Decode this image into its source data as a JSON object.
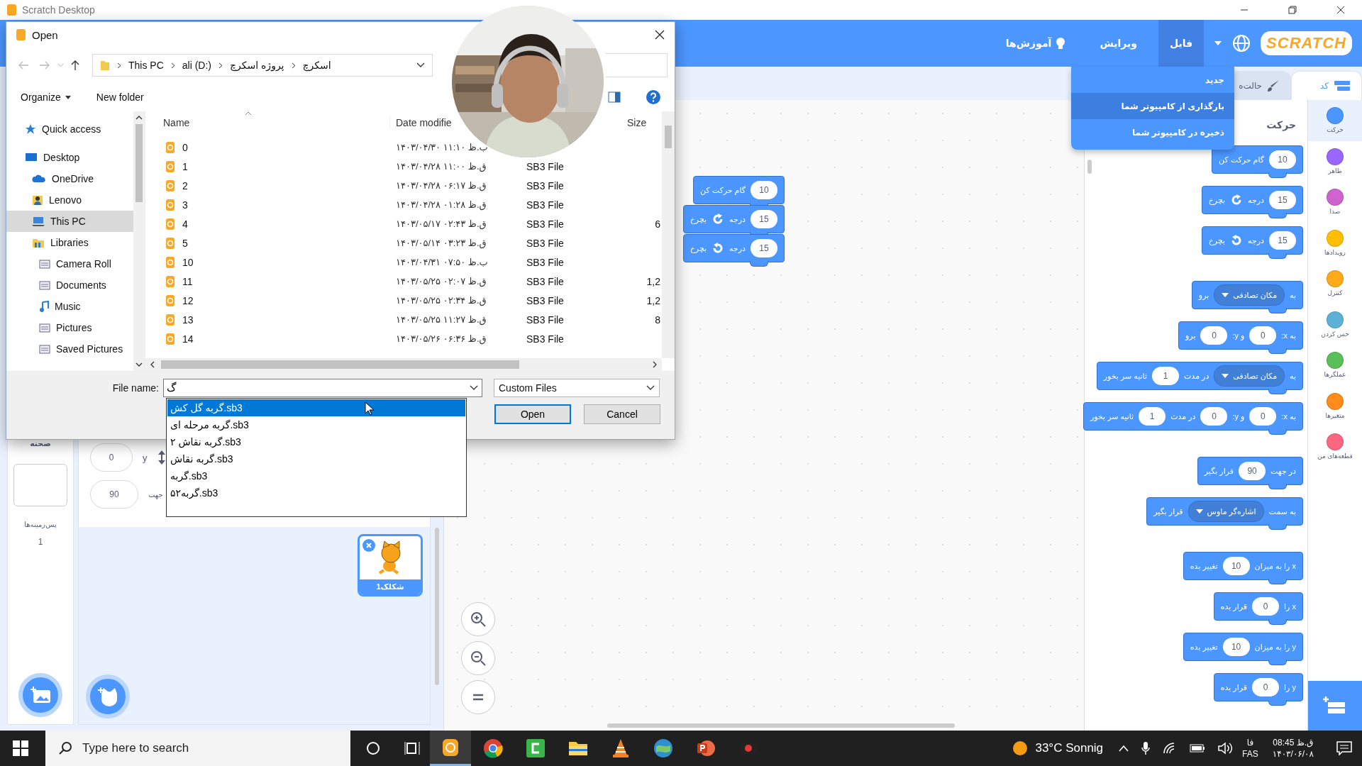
{
  "app_window": {
    "title": "Scratch Desktop"
  },
  "menu_bar": {
    "logo": "SCRATCH",
    "items": [
      {
        "label": "فایل",
        "selected": true,
        "kind": "plain"
      },
      {
        "label": "ویرایش",
        "selected": false,
        "kind": "plain"
      },
      {
        "label": "آموزش‌ها",
        "selected": false,
        "kind": "bulb"
      }
    ]
  },
  "file_menu": [
    {
      "label": "جدید",
      "selected": false
    },
    {
      "label": "بارگذاری از کامپیوتر شما",
      "selected": true
    },
    {
      "label": "ذخیره در کامپیوتر شما",
      "selected": false
    }
  ],
  "editor_tabs": [
    {
      "label": "کد",
      "selected": true,
      "kind": "code"
    },
    {
      "label": "حالت‌ه",
      "selected": false,
      "kind": "costumes"
    }
  ],
  "categories": [
    {
      "label": "حرکت",
      "color": "#4c97ff",
      "selected": true
    },
    {
      "label": "ظاهر",
      "color": "#9966ff",
      "selected": false
    },
    {
      "label": "صدا",
      "color": "#cf63cf",
      "selected": false
    },
    {
      "label": "رویدادها",
      "color": "#ffbf00",
      "selected": false
    },
    {
      "label": "کنترل",
      "color": "#ffab19",
      "selected": false
    },
    {
      "label": "حس کردن",
      "color": "#5cb1d6",
      "selected": false
    },
    {
      "label": "عملگرها",
      "color": "#59c059",
      "selected": false
    },
    {
      "label": "متغیرها",
      "color": "#ff8c1a",
      "selected": false
    },
    {
      "label": "قطعه‌های من",
      "color": "#ff6680",
      "selected": false
    }
  ],
  "palette": {
    "heading": "حرکت",
    "groups": [
      [
        {
          "parts": [
            {
              "kind": "input",
              "text": "10"
            },
            {
              "kind": "text",
              "text": "گام حرکت کن"
            }
          ]
        },
        {
          "parts": [
            {
              "kind": "input",
              "text": "15"
            },
            {
              "kind": "text",
              "text": "درجه"
            },
            {
              "kind": "turn-right"
            },
            {
              "kind": "text",
              "text": "بچرخ"
            }
          ]
        },
        {
          "parts": [
            {
              "kind": "input",
              "text": "15"
            },
            {
              "kind": "text",
              "text": "درجه"
            },
            {
              "kind": "turn-left"
            },
            {
              "kind": "text",
              "text": "بچرخ"
            }
          ]
        }
      ],
      [
        {
          "parts": [
            {
              "kind": "text",
              "text": "به"
            },
            {
              "kind": "menu",
              "text": "مکان تصادفی"
            },
            {
              "kind": "text",
              "text": "برو"
            }
          ]
        },
        {
          "parts": [
            {
              "kind": "text",
              "text": "به x:"
            },
            {
              "kind": "input",
              "text": "0"
            },
            {
              "kind": "text",
              "text": "و y:"
            },
            {
              "kind": "input",
              "text": "0"
            },
            {
              "kind": "text",
              "text": "برو"
            }
          ]
        },
        {
          "parts": [
            {
              "kind": "text",
              "text": "به"
            },
            {
              "kind": "menu",
              "text": "مکان تصادفی"
            },
            {
              "kind": "text",
              "text": "در مدت"
            },
            {
              "kind": "input",
              "text": "1"
            },
            {
              "kind": "text",
              "text": "ثانیه سر بخور"
            }
          ]
        },
        {
          "parts": [
            {
              "kind": "text",
              "text": "به x:"
            },
            {
              "kind": "input",
              "text": "0"
            },
            {
              "kind": "text",
              "text": "و y:"
            },
            {
              "kind": "input",
              "text": "0"
            },
            {
              "kind": "text",
              "text": "در مدت"
            },
            {
              "kind": "input",
              "text": "1"
            },
            {
              "kind": "text",
              "text": "ثانیه سر بخور"
            }
          ]
        }
      ],
      [
        {
          "parts": [
            {
              "kind": "text",
              "text": "در جهت"
            },
            {
              "kind": "input",
              "text": "90"
            },
            {
              "kind": "text",
              "text": "قرار بگیر"
            }
          ]
        },
        {
          "parts": [
            {
              "kind": "text",
              "text": "به سمت"
            },
            {
              "kind": "menu",
              "text": "اشاره‌گر ماوس"
            },
            {
              "kind": "text",
              "text": "قرار بگیر"
            }
          ]
        }
      ],
      [
        {
          "parts": [
            {
              "kind": "text",
              "text": "x را به میزان"
            },
            {
              "kind": "input",
              "text": "10"
            },
            {
              "kind": "text",
              "text": "تغییر بده"
            }
          ]
        },
        {
          "parts": [
            {
              "kind": "text",
              "text": "x را"
            },
            {
              "kind": "input",
              "text": "0"
            },
            {
              "kind": "text",
              "text": "قرار بده"
            }
          ]
        },
        {
          "parts": [
            {
              "kind": "text",
              "text": "y را به میزان"
            },
            {
              "kind": "input",
              "text": "10"
            },
            {
              "kind": "text",
              "text": "تغییر بده"
            }
          ]
        },
        {
          "parts": [
            {
              "kind": "text",
              "text": "y را"
            },
            {
              "kind": "input",
              "text": "0"
            },
            {
              "kind": "text",
              "text": "قرار بده"
            }
          ]
        }
      ]
    ]
  },
  "workspace": {
    "blocks": [
      {
        "parts": [
          {
            "kind": "input",
            "text": "10"
          },
          {
            "kind": "text",
            "text": "گام حرکت کن"
          }
        ]
      },
      {
        "parts": [
          {
            "kind": "input",
            "text": "15"
          },
          {
            "kind": "text",
            "text": "درجه"
          },
          {
            "kind": "turn-right"
          },
          {
            "kind": "text",
            "text": "بچرخ"
          }
        ]
      },
      {
        "parts": [
          {
            "kind": "input",
            "text": "15"
          },
          {
            "kind": "text",
            "text": "درجه"
          },
          {
            "kind": "turn-left"
          },
          {
            "kind": "text",
            "text": "بچرخ"
          }
        ]
      }
    ]
  },
  "sprite_info": {
    "y_value": "0",
    "y_label": "y",
    "direction": "90",
    "direction_label": "جهت"
  },
  "sprites": [
    {
      "name": "شکلک1",
      "selected": true
    }
  ],
  "stage_panel": {
    "title": "صحنه",
    "backdrops_label": "پس‌زمینه‌ها",
    "backdrop_count": "1"
  },
  "open_dialog": {
    "title": "Open",
    "path": {
      "computer": "This PC",
      "drive": "ali (D:)",
      "parent_folder": "پروژه اسکرچ",
      "folder": "اسکرچ"
    },
    "toolbar": {
      "organize": "Organize",
      "new_folder": "New folder"
    },
    "nav": [
      {
        "label": "Quick access",
        "kind": "star",
        "selected": false
      },
      {
        "label": "Desktop",
        "kind": "desktop",
        "selected": false,
        "children": [
          {
            "label": "OneDrive",
            "kind": "cloud",
            "selected": false
          },
          {
            "label": "Lenovo",
            "kind": "user",
            "selected": false
          },
          {
            "label": "This PC",
            "kind": "pc",
            "selected": true
          },
          {
            "label": "Libraries",
            "kind": "library",
            "selected": false,
            "children": [
              {
                "label": "Camera Roll",
                "kind": "folder",
                "selected": false
              },
              {
                "label": "Documents",
                "kind": "folder",
                "selected": false
              },
              {
                "label": "Music",
                "kind": "music",
                "selected": false
              },
              {
                "label": "Pictures",
                "kind": "folder",
                "selected": false
              },
              {
                "label": "Saved Pictures",
                "kind": "folder",
                "selected": false
              }
            ]
          }
        ]
      }
    ],
    "columns": {
      "name": "Name",
      "date_modified": "Date modifie",
      "size": "Size"
    },
    "files": [
      {
        "name": "0",
        "date": "۱۴۰۳/۰۴/۳۰ ب.ظ ۱۱:۱۰"
      },
      {
        "name": "1",
        "date": "۱۴۰۳/۰۴/۲۸ ق.ظ ۱۱:۰۰",
        "type": "SB3 File"
      },
      {
        "name": "2",
        "date": "۱۴۰۳/۰۴/۲۸ ق.ظ ۰۶:۱۷",
        "type": "SB3 File"
      },
      {
        "name": "3",
        "date": "۱۴۰۳/۰۴/۲۸ ق.ظ ۰۱:۲۸",
        "type": "SB3 File"
      },
      {
        "name": "4",
        "date": "۱۴۰۳/۰۵/۱۷ ق.ظ ۰۲:۴۳",
        "type": "SB3 File",
        "size": "6"
      },
      {
        "name": "5",
        "date": "۱۴۰۳/۰۵/۱۴ ق.ظ ۰۳:۲۳",
        "type": "SB3 File"
      },
      {
        "name": "10",
        "date": "۱۴۰۳/۰۴/۳۱ ب.ظ ۰۷:۵۰",
        "type": "SB3 File"
      },
      {
        "name": "11",
        "date": "۱۴۰۳/۰۵/۲۵ ق.ظ ۰۲:۰۷",
        "type": "SB3 File",
        "size": "1,2"
      },
      {
        "name": "12",
        "date": "۱۴۰۳/۰۵/۲۵ ق.ظ ۰۲:۳۴",
        "type": "SB3 File",
        "size": "1,2"
      },
      {
        "name": "13",
        "date": "۱۴۰۳/۰۵/۲۵ ق.ظ ۱۱:۲۷",
        "type": "SB3 File",
        "size": "8"
      },
      {
        "name": "14",
        "date": "۱۴۰۳/۰۵/۲۶ ق.ظ ۰۶:۳۶",
        "type": "SB3 File"
      }
    ],
    "file_name_label": "File name:",
    "file_name": "گ",
    "autocomplete": [
      {
        "label": "گربه گل کش.sb3",
        "selected": true
      },
      {
        "label": "گربه مرحله ای.sb3",
        "selected": false
      },
      {
        "label": "گربه نقاش ۲.sb3",
        "selected": false
      },
      {
        "label": "گربه نقاش.sb3",
        "selected": false
      },
      {
        "label": "گربه.sb3",
        "selected": false
      },
      {
        "label": "گربه۵۲.sb3",
        "selected": false
      }
    ],
    "file_type": "Custom Files",
    "open_button": {
      "label": "Open",
      "default": true
    },
    "cancel_button": {
      "label": "Cancel",
      "default": false
    }
  },
  "taskbar": {
    "search_placeholder": "Type here to search",
    "apps": [
      {
        "kind": "scratch",
        "selected": true
      },
      {
        "kind": "chrome",
        "selected": false
      },
      {
        "kind": "camtasia",
        "selected": false
      },
      {
        "kind": "explorer",
        "selected": false
      },
      {
        "kind": "vlc",
        "selected": false
      },
      {
        "kind": "globe",
        "selected": false
      },
      {
        "kind": "powerpoint",
        "selected": false
      },
      {
        "kind": "recorder",
        "selected": false
      }
    ],
    "weather": "33°C Sonnig",
    "language": "فا",
    "language_code": "FAS",
    "time": "08:45 ق.ظ",
    "date": "۱۴۰۳/۰۶/۰۸"
  }
}
